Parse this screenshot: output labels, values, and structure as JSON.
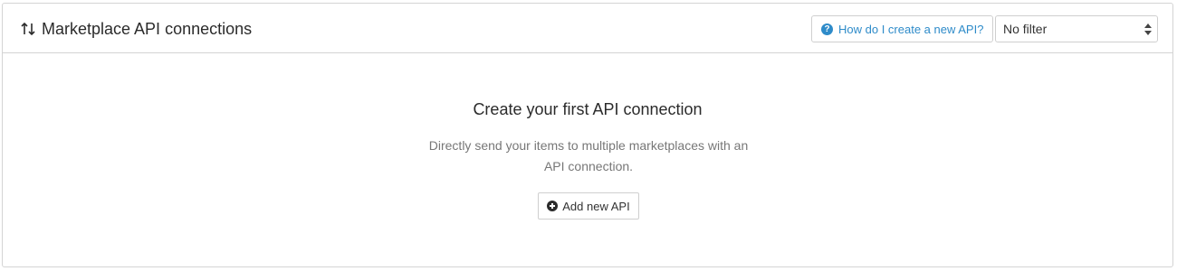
{
  "header": {
    "title": "Marketplace API connections",
    "title_icon": "sort-arrows-icon",
    "help_button": {
      "label": "How do I create a new API?",
      "icon": "question-circle-icon"
    },
    "filter": {
      "selected": "No filter"
    }
  },
  "empty_state": {
    "title": "Create your first API connection",
    "description_line1": "Directly send your items to multiple marketplaces with an",
    "description_line2": "API connection.",
    "add_button": {
      "label": "Add new API",
      "icon": "plus-circle-icon"
    }
  },
  "colors": {
    "accent": "#2e8bc9",
    "border": "#d4d4d4",
    "text": "#2b2b2b",
    "muted_text": "#777777"
  }
}
